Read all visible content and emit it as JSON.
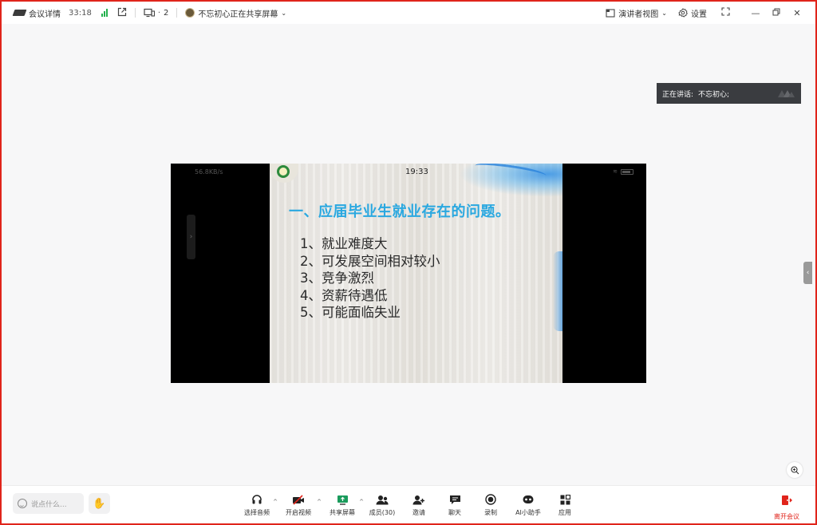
{
  "topbar": {
    "meeting_details": "会议详情",
    "duration": "33:18",
    "devices_count": "2",
    "sharing_notice": "不忘初心正在共享屏幕",
    "view_mode": "演讲者视图",
    "settings": "设置"
  },
  "speaker": {
    "label": "正在讲话:",
    "name": "不忘初心;"
  },
  "share": {
    "phone_status_left": "56.8KB/s",
    "time": "19:33",
    "slide_title": "一、应届毕业生就业存在的问题。",
    "items": [
      "1、就业难度大",
      "2、可发展空间相对较小",
      "3、竞争激烈",
      "4、资薪待遇低",
      "5、可能面临失业"
    ]
  },
  "bottombar": {
    "chat_placeholder": "说点什么...",
    "tools": {
      "audio": "选择音频",
      "video": "开启视频",
      "share": "共享屏幕",
      "members": "成员(30)",
      "invite": "邀请",
      "chat": "聊天",
      "record": "录制",
      "ai": "AI小助手",
      "apps": "应用"
    },
    "leave": "离开会议"
  },
  "colors": {
    "accent": "#2aa8e0",
    "danger": "#e0241b",
    "signal": "#23b14d"
  }
}
